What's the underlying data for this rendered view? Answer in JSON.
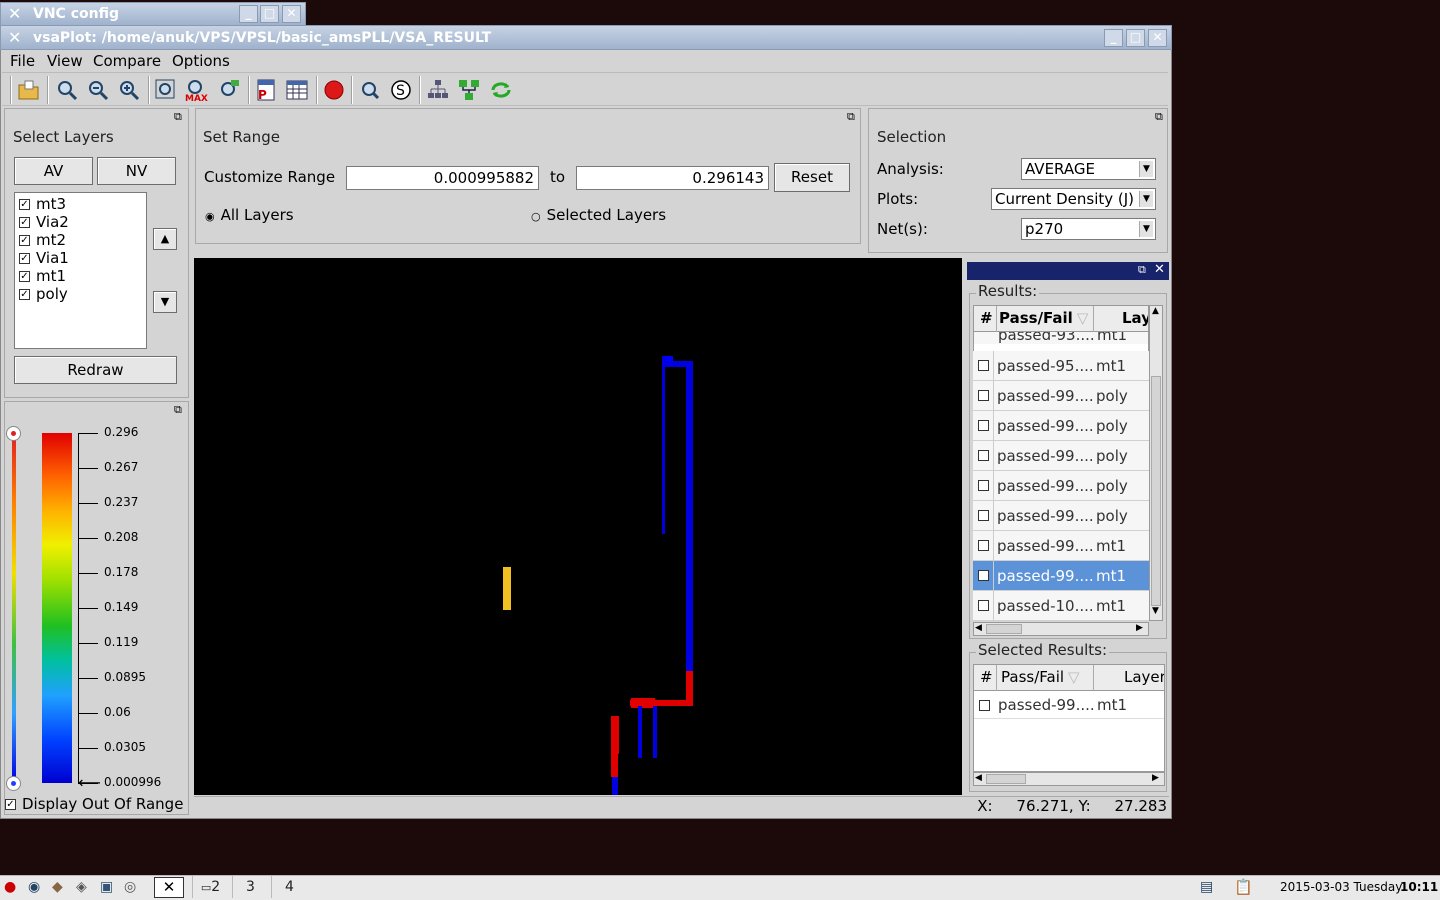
{
  "bg_window": {
    "title": "VNC config"
  },
  "window": {
    "title": "vsaPlot: /home/anuk/VPS/VPSL/basic_amsPLL/VSA_RESULT"
  },
  "menu": [
    "File",
    "View",
    "Compare",
    "Options"
  ],
  "toolbar_icons": [
    "open-folder-icon",
    "zoom-icon",
    "zoom-out-icon",
    "zoom-in-icon",
    "zoom-fit-icon",
    "zoom-max-icon",
    "find-icon",
    "pdf-icon",
    "table-icon",
    "record-icon",
    "inspect-icon",
    "s-icon",
    "hierarchy-icon",
    "network-icon",
    "refresh-icon"
  ],
  "layers": {
    "title": "Select Layers",
    "av_label": "AV",
    "nv_label": "NV",
    "items": [
      "mt3",
      "Via2",
      "mt2",
      "Via1",
      "mt1",
      "poly"
    ],
    "redraw_label": "Redraw"
  },
  "range": {
    "title": "Set Range",
    "customize_label": "Customize Range",
    "from": "0.000995882",
    "to_label": "to",
    "to": "0.296143",
    "reset_label": "Reset",
    "all_layers": "All Layers",
    "selected_layers": "Selected Layers"
  },
  "selection": {
    "title": "Selection",
    "analysis_label": "Analysis:",
    "analysis_value": "AVERAGE",
    "plots_label": "Plots:",
    "plots_value": "Current Density (J)",
    "nets_label": "Net(s):",
    "nets_value": "p270"
  },
  "legend": {
    "ticks": [
      "0.296",
      "0.267",
      "0.237",
      "0.208",
      "0.178",
      "0.149",
      "0.119",
      "0.0895",
      "0.06",
      "0.0305",
      "0.000996"
    ],
    "display_out_of_range": "Display Out Of Range"
  },
  "results": {
    "title": "Results:",
    "headers": [
      "#",
      "Pass/Fail",
      "Lay"
    ],
    "rows": [
      [
        "passed-95....",
        "mt1"
      ],
      [
        "passed-99....",
        "poly"
      ],
      [
        "passed-99....",
        "poly"
      ],
      [
        "passed-99....",
        "poly"
      ],
      [
        "passed-99....",
        "poly"
      ],
      [
        "passed-99....",
        "poly"
      ],
      [
        "passed-99....",
        "mt1"
      ],
      [
        "passed-99....",
        "mt1"
      ],
      [
        "passed-10....",
        "mt1"
      ]
    ],
    "partial_top_row": [
      "passed-93....",
      "mt1"
    ]
  },
  "selected_results": {
    "title": "Selected Results:",
    "headers": [
      "#",
      "Pass/Fail",
      "Layer"
    ],
    "rows": [
      [
        "passed-99....",
        "mt1"
      ]
    ]
  },
  "status": {
    "coords": "X:     76.271, Y:     27.283"
  },
  "taskbar": {
    "desktops": [
      "2",
      "3",
      "4"
    ],
    "date": "2015-03-03 Tuesday",
    "time": "10:11"
  },
  "colors": {
    "selected_row": "#5b92d8",
    "layout_blue": "#0000e0",
    "layout_red": "#e00000",
    "layout_yellow": "#f0c020"
  }
}
